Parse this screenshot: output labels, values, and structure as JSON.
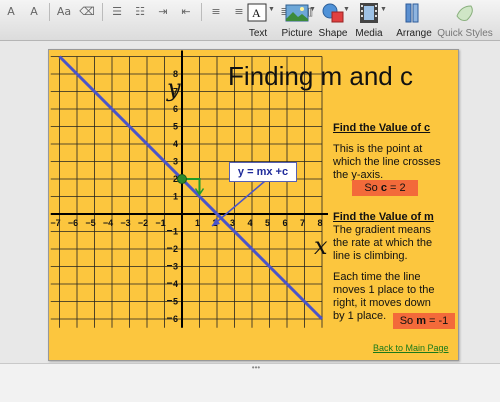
{
  "toolbar": {
    "text_label": "Text",
    "picture_label": "Picture",
    "shape_label": "Shape",
    "media_label": "Media",
    "arrange_label": "Arrange",
    "quick_styles_label": "Quick Styles"
  },
  "slide": {
    "title": "Finding m and c",
    "y_axis_label": "y",
    "x_axis_label": "x",
    "equation": "y = mx +c",
    "section1_heading": "Find the Value of c",
    "section1_text": "This is the point at which the line crosses the y-axis.",
    "c_result_prefix": "So ",
    "c_result_bold": "c",
    "c_result_suffix": " = 2",
    "section2_heading": "Find the Value of m",
    "section2_text": "The gradient means the rate at which the line is climbing.",
    "section3_text": "Each time the line moves 1 place to the right, it moves down by 1 place.",
    "m_result_prefix": "So ",
    "m_result_bold": "m",
    "m_result_suffix": " = -1",
    "back_link": "Back to Main Page",
    "x_ticks": [
      "−7",
      "−6",
      "−5",
      "−4",
      "−3",
      "−2",
      "−1",
      "1",
      "2",
      "3",
      "4",
      "5",
      "6",
      "7",
      "8"
    ],
    "y_ticks": [
      "8",
      "7",
      "6",
      "5",
      "4",
      "3",
      "2",
      "1",
      "1",
      "2",
      "3",
      "4",
      "5",
      "6"
    ],
    "y_ticks_negative": [
      false,
      false,
      false,
      false,
      false,
      false,
      false,
      false,
      true,
      true,
      true,
      true,
      true,
      true
    ]
  },
  "colors": {
    "slide_bg": "#fcc63e",
    "line": "#4a54c9",
    "intercept_point": "#2d8a2d",
    "highlight": "#f36a3a"
  },
  "chart_data": {
    "type": "line",
    "x": [
      -7,
      8
    ],
    "y": [
      9,
      -6
    ],
    "xlim": [
      -7.5,
      8
    ],
    "ylim": [
      -6.5,
      9
    ],
    "grid": true,
    "slope": -1,
    "intercept": 2
  }
}
